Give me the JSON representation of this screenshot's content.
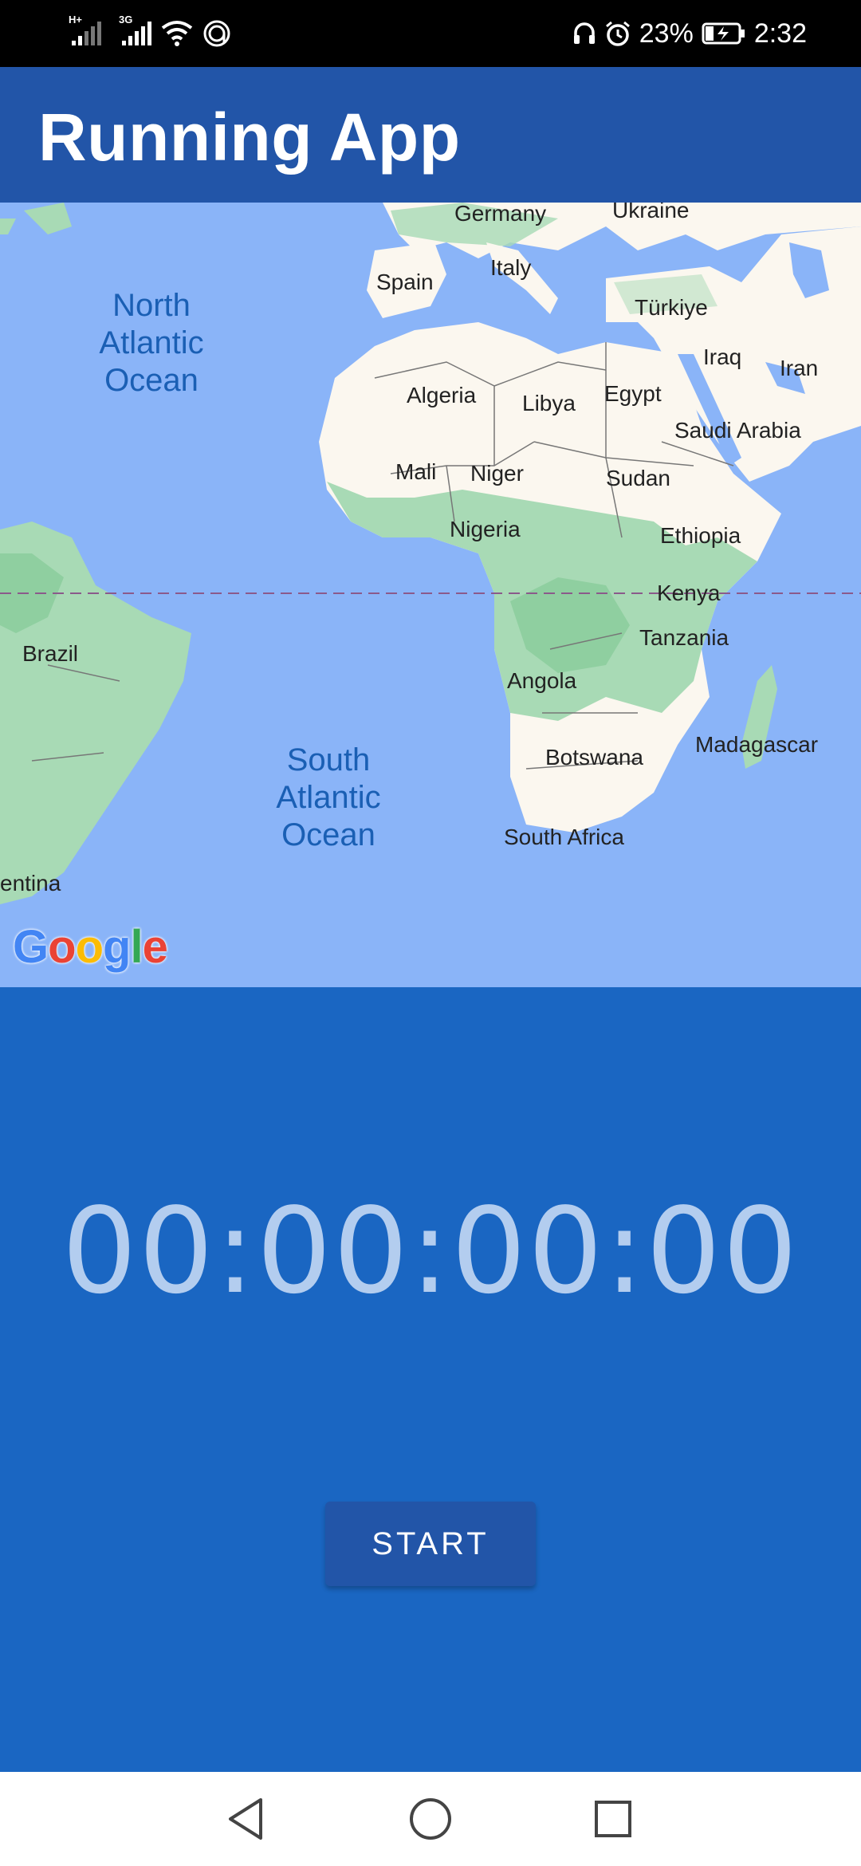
{
  "status_bar": {
    "network_1": "H+",
    "network_2": "3G",
    "battery": "23%",
    "time": "2:32",
    "icons": [
      "signal-icon",
      "wifi-icon",
      "hotspot-icon",
      "headset-icon",
      "alarm-icon",
      "battery-charging-icon"
    ]
  },
  "app_bar": {
    "title": "Running App"
  },
  "map": {
    "countries": {
      "germany": "Germany",
      "ukraine": "Ukraine",
      "spain": "Spain",
      "italy": "Italy",
      "turkiye": "Türkiye",
      "iraq": "Iraq",
      "iran": "Iran",
      "algeria": "Algeria",
      "libya": "Libya",
      "egypt": "Egypt",
      "saudi_arabia": "Saudi Arabia",
      "mali": "Mali",
      "niger": "Niger",
      "sudan": "Sudan",
      "nigeria": "Nigeria",
      "ethiopia": "Ethiopia",
      "kenya": "Kenya",
      "brazil": "Brazil",
      "tanzania": "Tanzania",
      "angola": "Angola",
      "madagascar": "Madagascar",
      "botswana": "Botswana",
      "south_africa": "South Africa",
      "argentina": "entina"
    },
    "oceans": {
      "north_atlantic": [
        "North",
        "Atlantic",
        "Ocean"
      ],
      "south_atlantic": [
        "South",
        "Atlantic",
        "Ocean"
      ]
    },
    "logo": {
      "g1": "G",
      "o1": "o",
      "o2": "o",
      "g2": "g",
      "l": "l",
      "e": "e"
    },
    "colors": {
      "ocean": "#8ab4f8",
      "land": "#fbf7ef",
      "vegetation": "#a8dab5",
      "equator": "#8b5a8b"
    }
  },
  "timer": {
    "display": "00:00:00:00"
  },
  "controls": {
    "start_label": "START"
  },
  "nav_bar": {
    "back": "back-icon",
    "home": "home-icon",
    "recents": "recents-icon"
  }
}
